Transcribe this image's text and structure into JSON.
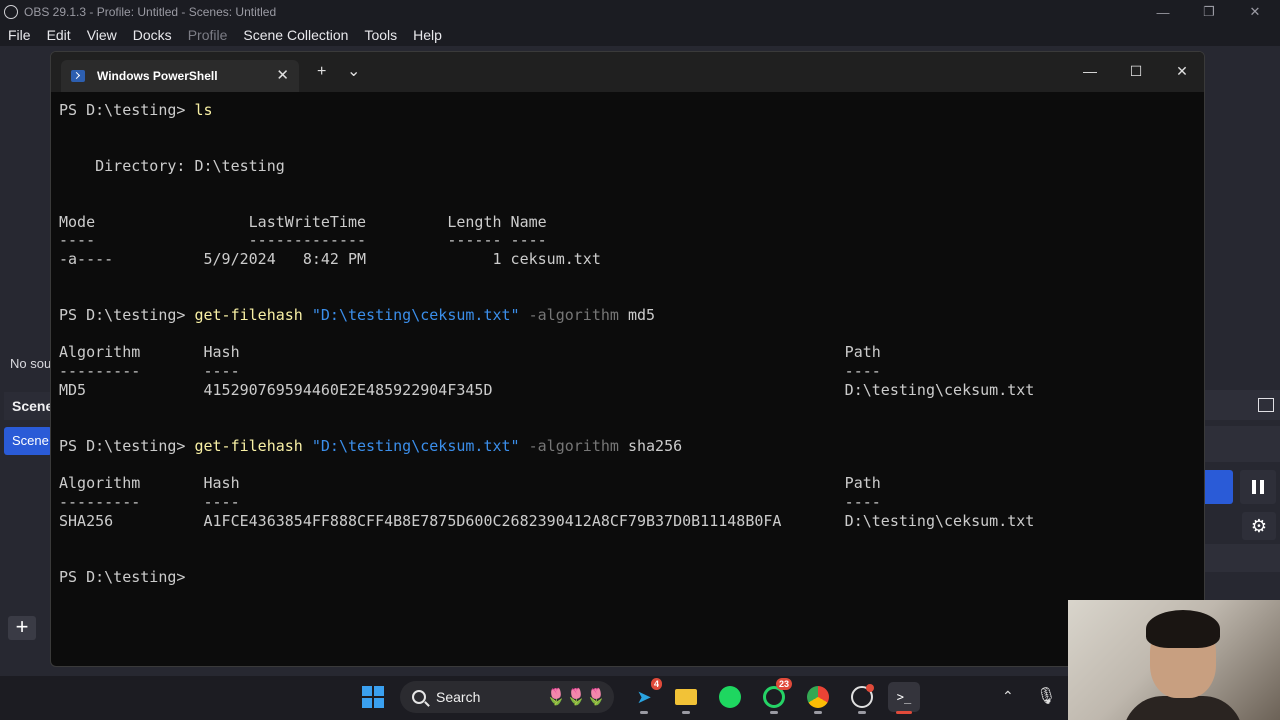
{
  "obs": {
    "title": "OBS 29.1.3 - Profile: Untitled - Scenes: Untitled",
    "menu": [
      "File",
      "Edit",
      "View",
      "Docks",
      "Profile",
      "Scene Collection",
      "Tools",
      "Help"
    ],
    "no_source_text": "No sou",
    "scenes_header": "Scene",
    "scene_item": "Scene",
    "add_button": "+"
  },
  "terminal": {
    "tab_title": "Windows PowerShell",
    "new_tab": "+",
    "dropdown": "⌄",
    "lines": {
      "l1_prompt": "PS D:\\testing> ",
      "l1_cmd": "ls",
      "l2": "    Directory: D:\\testing",
      "l3": "Mode                 LastWriteTime         Length Name",
      "l4": "----                 -------------         ------ ----",
      "l5": "-a----          5/9/2024   8:42 PM              1 ceksum.txt",
      "l6_prompt": "PS D:\\testing> ",
      "l6_cmd": "get-filehash",
      "l6_arg": " \"D:\\testing\\ceksum.txt\"",
      "l6_flag": " -algorithm",
      "l6_val": " md5",
      "l7": "Algorithm       Hash                                                                   Path",
      "l8": "---------       ----                                                                   ----",
      "l9": "MD5             415290769594460E2E485922904F345D                                       D:\\testing\\ceksum.txt",
      "l10_prompt": "PS D:\\testing> ",
      "l10_cmd": "get-filehash",
      "l10_arg": " \"D:\\testing\\ceksum.txt\"",
      "l10_flag": " -algorithm",
      "l10_val": " sha256",
      "l11": "Algorithm       Hash                                                                   Path",
      "l12": "---------       ----                                                                   ----",
      "l13": "SHA256          A1FCE4363854FF888CFF4B8E7875D600C2682390412A8CF79B37D0B11148B0FA       D:\\testing\\ceksum.txt",
      "l14_prompt": "PS D:\\testing> "
    }
  },
  "taskbar": {
    "search_label": "Search",
    "telegram_badge": "4",
    "whatsapp_badge": "23"
  },
  "colors": {
    "prompt_cmd": "#f9f1a5",
    "string": "#3b8eea",
    "param": "#767676",
    "accent": "#2a5bd7"
  }
}
